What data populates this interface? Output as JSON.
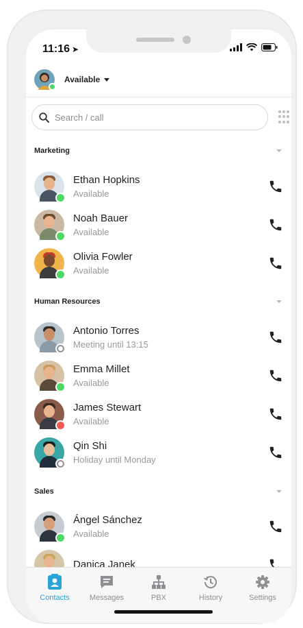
{
  "status": {
    "time": "11:16",
    "arrow": "➤"
  },
  "header": {
    "presence_label": "Available"
  },
  "search": {
    "placeholder": "Search / call"
  },
  "sections": [
    {
      "title": "Marketing"
    },
    {
      "title": "Human Resources"
    },
    {
      "title": "Sales"
    }
  ],
  "contacts": [
    {
      "name": "Ethan Hopkins",
      "status": "Available"
    },
    {
      "name": "Noah Bauer",
      "status": "Available"
    },
    {
      "name": "Olivia Fowler",
      "status": "Available"
    },
    {
      "name": "Antonio Torres",
      "status": "Meeting until 13:15"
    },
    {
      "name": "Emma Millet",
      "status": "Available"
    },
    {
      "name": "James Stewart",
      "status": "Available"
    },
    {
      "name": "Qin Shi",
      "status": "Holiday until Monday"
    },
    {
      "name": "Ángel Sánchez",
      "status": "Available"
    },
    {
      "name": "Danica Janek",
      "status": ""
    }
  ],
  "tabs": [
    {
      "label": "Contacts",
      "icon": "contacts-icon"
    },
    {
      "label": "Messages",
      "icon": "messages-icon"
    },
    {
      "label": "PBX",
      "icon": "pbx-icon"
    },
    {
      "label": "History",
      "icon": "history-icon"
    },
    {
      "label": "Settings",
      "icon": "settings-icon"
    }
  ],
  "colors": {
    "accent": "#2aa3d8",
    "available": "#4cd964",
    "busy": "#f25a4f"
  }
}
